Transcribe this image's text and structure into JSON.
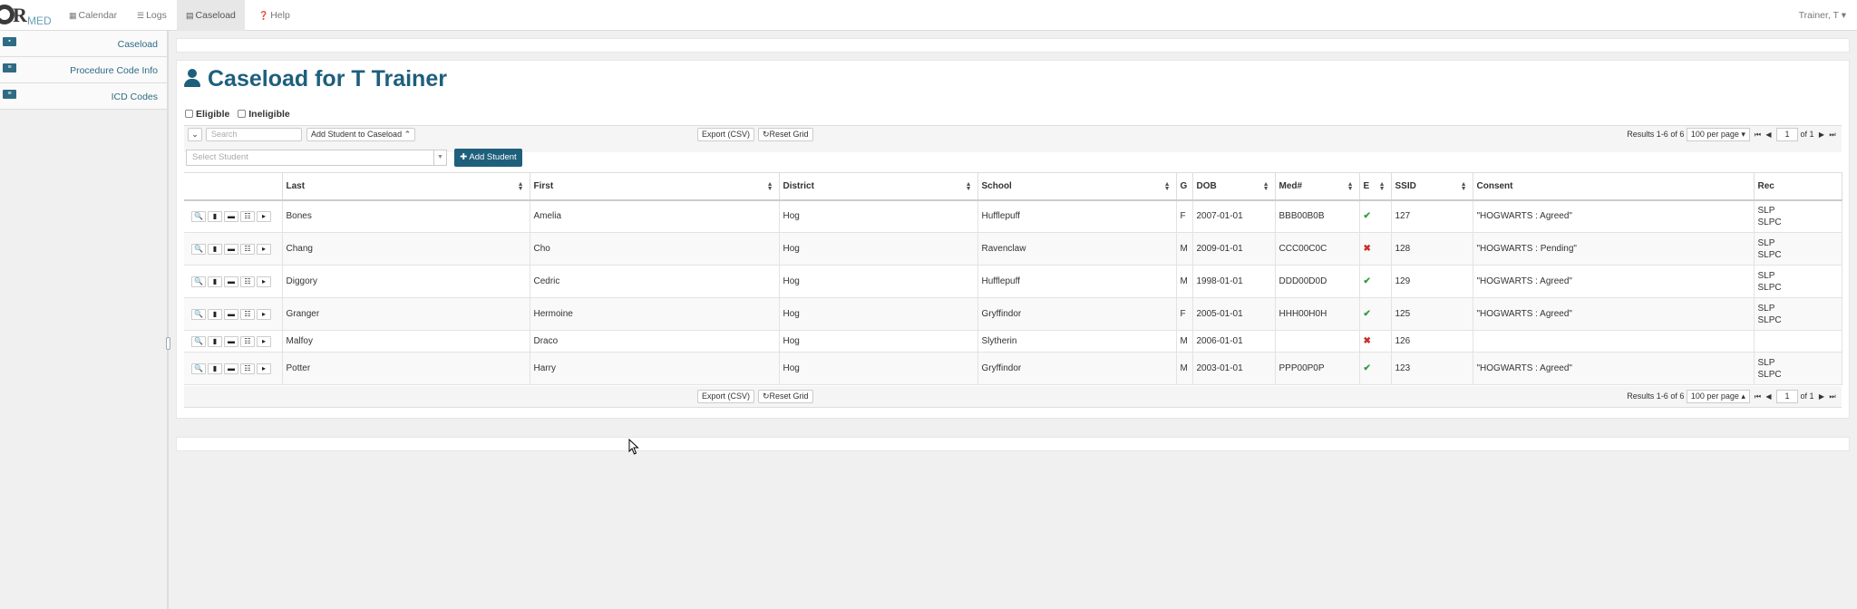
{
  "nav": {
    "calendar": "Calendar",
    "logs": "Logs",
    "caseload": "Caseload",
    "help": "Help",
    "user": "Trainer, T"
  },
  "brand": {
    "r": "R",
    "med": "MED"
  },
  "sidebar": {
    "items": [
      {
        "label": "Caseload",
        "icon": "home-icon"
      },
      {
        "label": "Procedure Code Info",
        "icon": "table-icon"
      },
      {
        "label": "ICD Codes",
        "icon": "list-icon"
      }
    ]
  },
  "page": {
    "title": "Caseload for T Trainer"
  },
  "filters": {
    "eligible": "Eligible",
    "ineligible": "Ineligible"
  },
  "toolbar": {
    "search_placeholder": "Search",
    "add_to_caseload": "Add Student to Caseload",
    "export": "Export (CSV)",
    "reset": "Reset Grid",
    "results": "Results 1-6  of 6",
    "per_page": "100 per page",
    "page": "1",
    "of": "of 1",
    "select_student": "Select Student",
    "add_student": "Add Student"
  },
  "table": {
    "headers": [
      "",
      "Last",
      "First",
      "District",
      "School",
      "G",
      "DOB",
      "Med#",
      "E",
      "SSID",
      "Consent",
      "Rec"
    ],
    "rows": [
      {
        "last": "Bones",
        "first": "Amelia",
        "district": "Hog",
        "school": "Hufflepuff",
        "g": "F",
        "dob": "2007-01-01",
        "med": "BBB00B0B",
        "e": "✔",
        "eligible": true,
        "ssid": "127",
        "consent": "\"HOGWARTS : Agreed\"",
        "rec1": "SLP",
        "rec2": "SLPC"
      },
      {
        "last": "Chang",
        "first": "Cho",
        "district": "Hog",
        "school": "Ravenclaw",
        "g": "M",
        "dob": "2009-01-01",
        "med": "CCC00C0C",
        "e": "✖",
        "eligible": false,
        "ssid": "128",
        "consent": "\"HOGWARTS : Pending\"",
        "rec1": "SLP",
        "rec2": "SLPC"
      },
      {
        "last": "Diggory",
        "first": "Cedric",
        "district": "Hog",
        "school": "Hufflepuff",
        "g": "M",
        "dob": "1998-01-01",
        "med": "DDD00D0D",
        "e": "✔",
        "eligible": true,
        "ssid": "129",
        "consent": "\"HOGWARTS : Agreed\"",
        "rec1": "SLP",
        "rec2": "SLPC"
      },
      {
        "last": "Granger",
        "first": "Hermoine",
        "district": "Hog",
        "school": "Gryffindor",
        "g": "F",
        "dob": "2005-01-01",
        "med": "HHH00H0H",
        "e": "✔",
        "eligible": true,
        "ssid": "125",
        "consent": "\"HOGWARTS : Agreed\"",
        "rec1": "SLP",
        "rec2": "SLPC"
      },
      {
        "last": "Malfoy",
        "first": "Draco",
        "district": "Hog",
        "school": "Slytherin",
        "g": "M",
        "dob": "2006-01-01",
        "med": "",
        "e": "✖",
        "eligible": false,
        "ssid": "126",
        "consent": "",
        "rec1": "",
        "rec2": ""
      },
      {
        "last": "Potter",
        "first": "Harry",
        "district": "Hog",
        "school": "Gryffindor",
        "g": "M",
        "dob": "2003-01-01",
        "med": "PPP00P0P",
        "e": "✔",
        "eligible": true,
        "ssid": "123",
        "consent": "\"HOGWARTS : Agreed\"",
        "rec1": "SLP",
        "rec2": "SLPC"
      }
    ]
  },
  "colors": {
    "primary": "#1e5f7c",
    "ok": "#2e9e3e",
    "bad": "#c9302c"
  }
}
